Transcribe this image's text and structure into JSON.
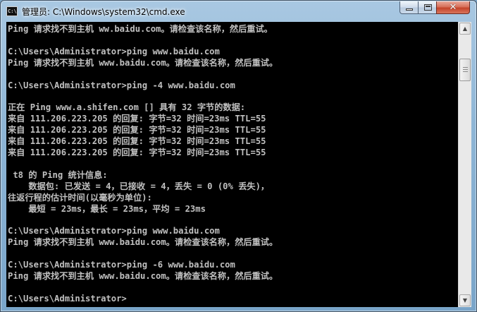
{
  "window": {
    "title": "管理员: C:\\Windows\\system32\\cmd.exe",
    "icon": "cmd-icon",
    "icon_text": "C:\\"
  },
  "controls": {
    "minimize": "minimize-icon",
    "maximize": "maximize-icon",
    "close": "close-icon",
    "close_glyph": "✕"
  },
  "console": {
    "lines": [
      "Ping 请求找不到主机 ww.baidu.com。请检查该名称，然后重试。",
      "",
      "C:\\Users\\Administrator>ping www.baidu.com",
      "Ping 请求找不到主机 www.baidu.com。请检查该名称，然后重试。",
      "",
      "C:\\Users\\Administrator>ping -4 www.baidu.com",
      "",
      "正在 Ping www.a.shifen.com [] 具有 32 字节的数据:",
      "来自 111.206.223.205 的回复: 字节=32 时间=23ms TTL=55",
      "来自 111.206.223.205 的回复: 字节=32 时间=23ms TTL=55",
      "来自 111.206.223.205 的回复: 字节=32 时间=23ms TTL=55",
      "来自 111.206.223.205 的回复: 字节=32 时间=23ms TTL=55",
      "",
      " t8 的 Ping 统计信息:",
      "    数据包: 已发送 = 4，已接收 = 4，丢失 = 0 (0% 丢失)，",
      "往返行程的估计时间(以毫秒为单位):",
      "    最短 = 23ms，最长 = 23ms，平均 = 23ms",
      "",
      "C:\\Users\\Administrator>ping www.baidu.com",
      "Ping 请求找不到主机 www.baidu.com。请检查该名称，然后重试。",
      "",
      "C:\\Users\\Administrator>ping -6 www.baidu.com",
      "Ping 请求找不到主机 www.baidu.com。请检查该名称，然后重试。",
      "",
      "C:\\Users\\Administrator>"
    ]
  },
  "scrollbar": {
    "up_glyph": "▲",
    "down_glyph": "▼",
    "position_fraction": 0.1
  },
  "colors": {
    "console_bg": "#000000",
    "console_text": "#c0c0c0",
    "close_button": "#c4432a"
  }
}
